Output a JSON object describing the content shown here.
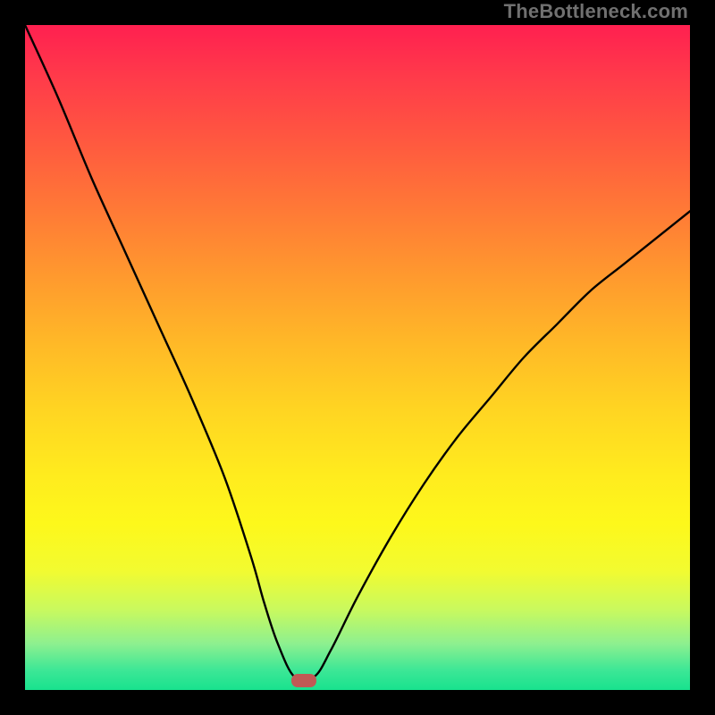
{
  "watermark": "TheBottleneck.com",
  "chart_data": {
    "type": "line",
    "title": "",
    "xlabel": "",
    "ylabel": "",
    "xlim": [
      0,
      100
    ],
    "ylim": [
      0,
      100
    ],
    "grid": false,
    "legend": false,
    "series": [
      {
        "name": "bottleneck-curve",
        "x": [
          0,
          5,
          10,
          15,
          20,
          25,
          30,
          34,
          36,
          38,
          40.5,
          43.5,
          46,
          50,
          55,
          60,
          65,
          70,
          75,
          80,
          85,
          90,
          95,
          100
        ],
        "y": [
          100,
          89,
          77,
          66,
          55,
          44,
          32,
          20,
          13,
          7,
          2,
          2,
          6,
          14,
          23,
          31,
          38,
          44,
          50,
          55,
          60,
          64,
          68,
          72
        ]
      }
    ],
    "marker": {
      "x": 42,
      "y": 1.5,
      "color": "#c05a55"
    },
    "background_gradient": {
      "top": "#ff2050",
      "mid": "#ffe822",
      "bottom": "#18e28e"
    }
  }
}
